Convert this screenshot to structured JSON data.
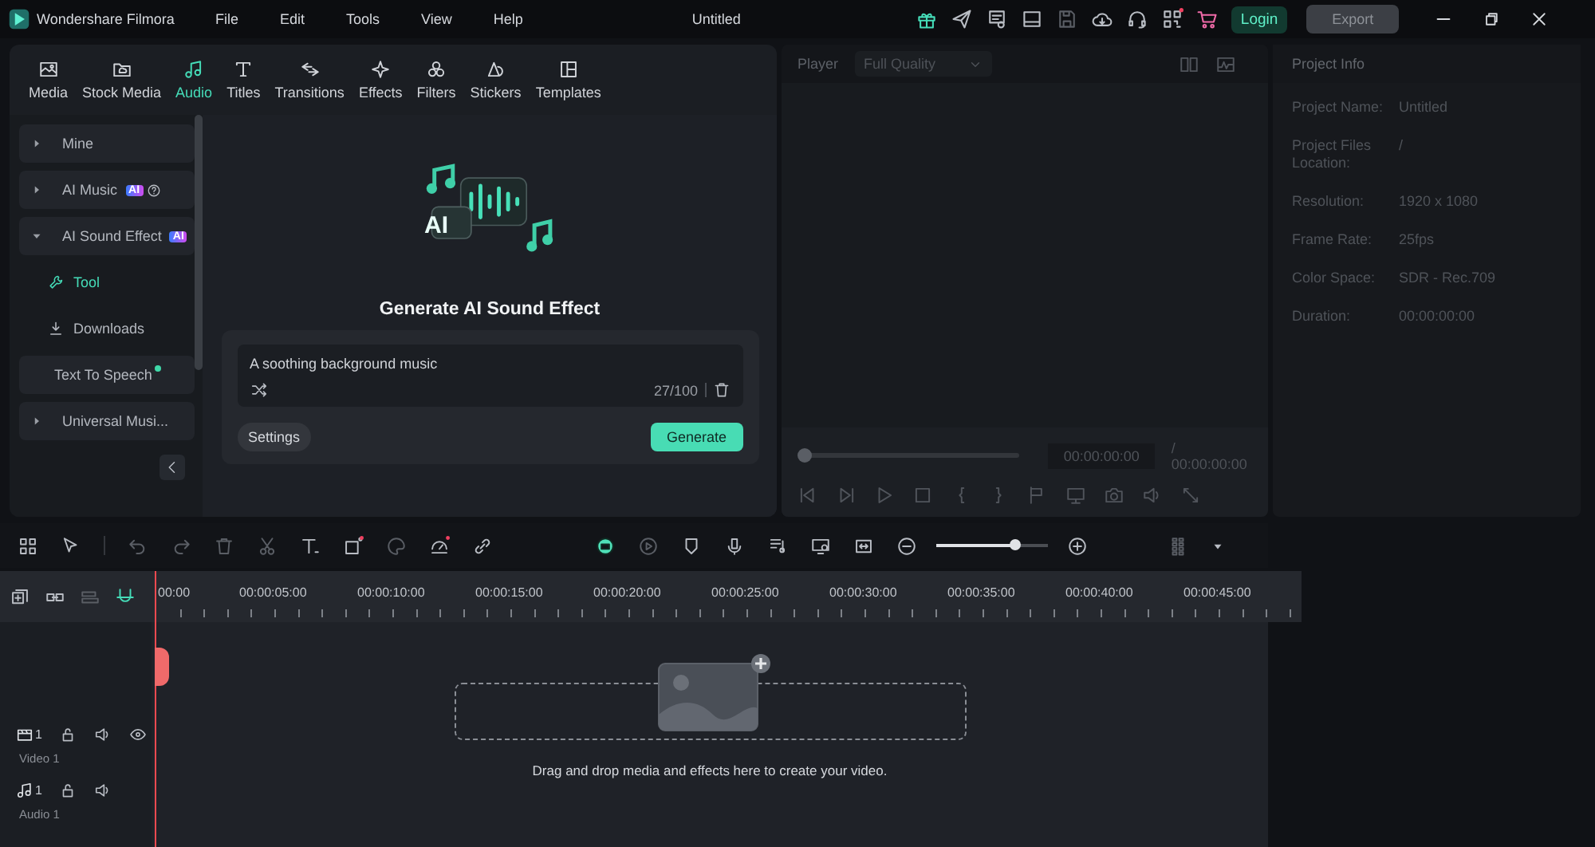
{
  "app": {
    "name": "Wondershare Filmora"
  },
  "menu": [
    "File",
    "Edit",
    "Tools",
    "View",
    "Help"
  ],
  "window": {
    "title": "Untitled"
  },
  "header": {
    "login": "Login",
    "export": {
      "label": "Export",
      "disabled": true
    }
  },
  "tabs": [
    {
      "label": "Media",
      "selected": false
    },
    {
      "label": "Stock Media",
      "selected": false
    },
    {
      "label": "Audio",
      "selected": true
    },
    {
      "label": "Titles",
      "selected": false
    },
    {
      "label": "Transitions",
      "selected": false
    },
    {
      "label": "Effects",
      "selected": false
    },
    {
      "label": "Filters",
      "selected": false
    },
    {
      "label": "Stickers",
      "selected": false
    },
    {
      "label": "Templates",
      "selected": false
    }
  ],
  "sidebar": [
    {
      "kind": "group",
      "label": "Mine",
      "expanded": false,
      "help": false
    },
    {
      "kind": "group",
      "label": "AI Music",
      "expanded": false,
      "badge": "AI",
      "help": true
    },
    {
      "kind": "group",
      "label": "AI Sound Effect",
      "expanded": true,
      "badge": "AI",
      "help": false,
      "children": [
        {
          "kind": "tool",
          "label": "Tool",
          "selected": true
        },
        {
          "kind": "download",
          "label": "Downloads",
          "selected": false
        }
      ]
    },
    {
      "kind": "link",
      "label": "Text To Speech",
      "new": true
    },
    {
      "kind": "group",
      "label": "Universal Musi...",
      "expanded": false,
      "help": false
    }
  ],
  "generator": {
    "art_label": "AI",
    "title": "Generate AI Sound Effect",
    "prompt": "A soothing background music",
    "counter": "27/100",
    "settings": "Settings",
    "generate": "Generate"
  },
  "player": {
    "label": "Player",
    "quality": "Full Quality",
    "progress": {
      "level": 0
    },
    "current_time": "00:00:00:00",
    "total_time": "/ 00:00:00:00"
  },
  "project_info": {
    "title": "Project Info",
    "rows": [
      {
        "label": "Project Name:",
        "value": "Untitled"
      },
      {
        "label": "Project Files Location:",
        "value": "/"
      },
      {
        "label": "Resolution:",
        "value": "1920 x 1080"
      },
      {
        "label": "Frame Rate:",
        "value": "25fps"
      },
      {
        "label": "Color Space:",
        "value": "SDR - Rec.709"
      },
      {
        "label": "Duration:",
        "value": "00:00:00:00"
      }
    ]
  },
  "timeline": {
    "zoom": {
      "level": 0.7
    },
    "ruler": [
      "00:00",
      "00:00:05:00",
      "00:00:10:00",
      "00:00:15:00",
      "00:00:20:00",
      "00:00:25:00",
      "00:00:30:00",
      "00:00:35:00",
      "00:00:40:00",
      "00:00:45:00"
    ],
    "tracks": [
      {
        "kind": "video",
        "count": "1",
        "label": "Video 1"
      },
      {
        "kind": "audio",
        "count": "1",
        "label": "Audio 1"
      }
    ],
    "drop_hint": "Drag and drop media and effects here to create your video."
  }
}
